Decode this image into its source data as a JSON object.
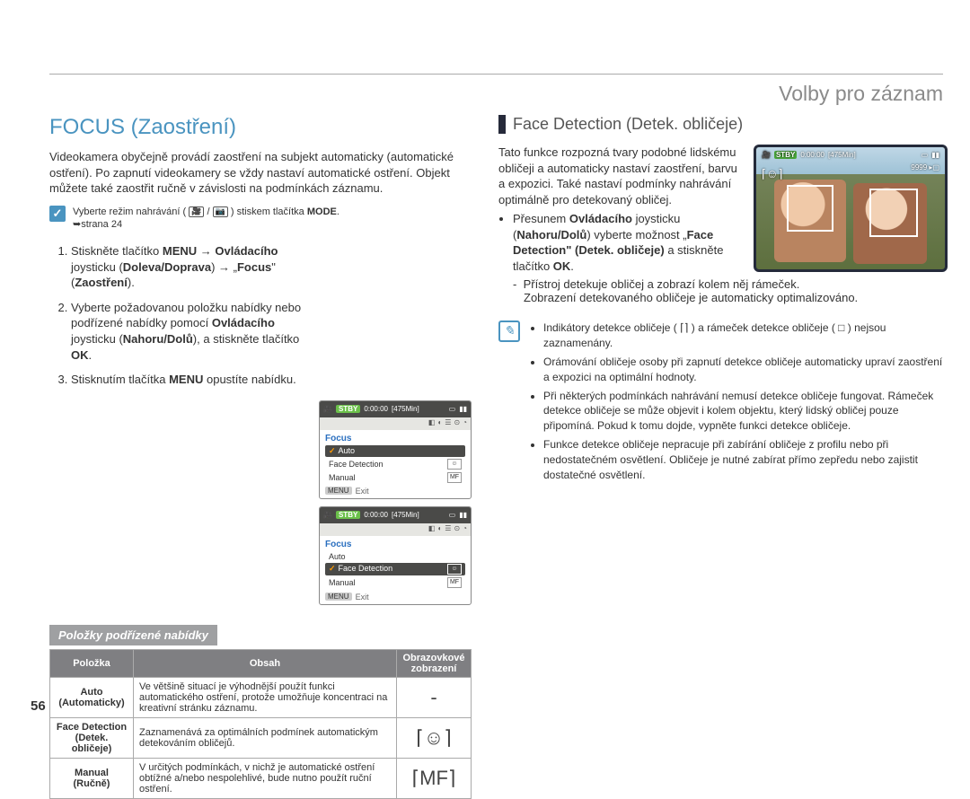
{
  "header": {
    "title": "Volby pro záznam"
  },
  "left": {
    "title": "FOCUS (Zaostření)",
    "intro": "Videokamera obyčejně provádí zaostření na subjekt automaticky (automatické ostření). Po zapnutí videokamery se vždy nastaví automatické ostření. Objekt můžete také zaostřit ručně v závislosti na podmínkách záznamu.",
    "mode_note_prefix": "Vyberte režim nahrávání ( ",
    "mode_note_mid": " / ",
    "mode_note_suffix": " ) stiskem tlačítka ",
    "mode_note_button": "MODE",
    "mode_note_page": "➥strana 24",
    "steps": [
      "Stiskněte tlačítko <b>MENU</b> → <b>Ovládacího</b> joysticku (<b>Doleva/Doprava</b>) → „<b>Focus</b>\" (<b>Zaostření</b>).",
      "Vyberte požadovanou položku nabídky nebo podřízené nabídky pomocí <b>Ovládacího</b> joysticku (<b>Nahoru/Dolů</b>), a stiskněte tlačítko <b>OK</b>.",
      "Stisknutím tlačítka <b>MENU</b> opustíte nabídku."
    ],
    "shot": {
      "status": "STBY",
      "time": "0:00:00",
      "remain": "[475Min]",
      "menu_title": "Focus",
      "items": [
        "Auto",
        "Face Detection",
        "Manual"
      ],
      "selected1": "Auto",
      "selected2": "Face Detection",
      "menu_btn": "MENU",
      "exit": "Exit"
    },
    "sub_bar": "Položky podřízené nabídky",
    "table": {
      "h1": "Položka",
      "h2": "Obsah",
      "h3": "Obrazovkové zobrazení",
      "rows": [
        {
          "item": "Auto (Automaticky)",
          "desc": "Ve většině situací je výhodnější použít funkci automatického ostření, protože umožňuje koncentraci na kreativní stránku záznamu.",
          "icon": "-"
        },
        {
          "item": "Face Detection (Detek. obličeje)",
          "desc": "Zaznamenává za optimálních podmínek automatickým detekováním obličejů.",
          "icon": "face-detect-icon"
        },
        {
          "item": "Manual (Ručně)",
          "desc": "V určitých podmínkách, v nichž je automatické ostření obtížné a/nebo nespolehlivé, bude nutno použít ruční ostření.",
          "icon": "manual-focus-icon"
        }
      ]
    }
  },
  "right": {
    "heading": "Face Detection (Detek. obličeje)",
    "para": "Tato funkce rozpozná tvary podobné lidskému obličeji a automaticky nastaví zaostření, barvu a expozici. Také nastaví podmínky nahrávání optimálně pro detekovaný obličej.",
    "bullet1_a": "Přesunem ",
    "bullet1_b": "Ovládacího",
    "bullet1_c": " joysticku (",
    "bullet1_d": "Nahoru/Dolů",
    "bullet1_e": ") vyberte možnost „",
    "bullet1_f": "Face Detection\" (Detek. obličeje)",
    "bullet1_g": " a stiskněte tlačítko ",
    "bullet1_h": "OK",
    "bullet1_i": ".",
    "sub_lines": [
      "Přístroj detekuje obličej a zobrazí kolem něj rámeček.",
      "Zobrazení detekovaného obličeje je automaticky optimalizováno."
    ],
    "preview": {
      "stby": "STBY",
      "time": "0:00:00",
      "remain": "[475Min]",
      "count": "9999",
      "face_icon": "face-detect-icon"
    },
    "notes": [
      "Indikátory detekce obličeje ( ⌈⌉ ) a rámeček detekce obličeje ( □ ) nejsou zaznamenány.",
      "Orámování obličeje osoby při zapnutí detekce obličeje automaticky upraví zaostření a expozici na optimální hodnoty.",
      "Při některých podmínkách nahrávání nemusí detekce obličeje fungovat. Rámeček detekce obličeje se může objevit i kolem objektu, který lidský obličej pouze připomíná. Pokud k tomu dojde, vypněte funkci detekce obličeje.",
      "Funkce detekce obličeje nepracuje při zabírání obličeje z profilu nebo při nedostatečném osvětlení. Obličeje je nutné zabírat přímo zepředu nebo zajistit dostatečné osvětlení."
    ]
  },
  "page_number": "56"
}
